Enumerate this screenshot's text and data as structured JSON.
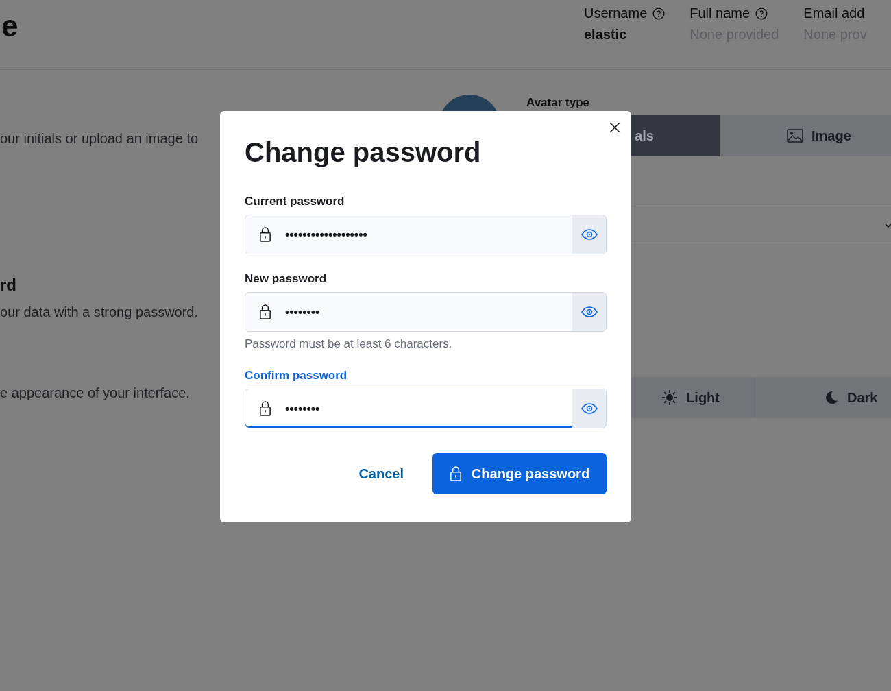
{
  "header": {
    "title": "e",
    "details": [
      {
        "label": "Username",
        "help": true,
        "value": "elastic",
        "empty": false
      },
      {
        "label": "Full name",
        "help": true,
        "value": "None provided",
        "empty": true
      },
      {
        "label": "Email add",
        "help": false,
        "value": "None prov",
        "empty": true
      }
    ]
  },
  "avatar_section": {
    "description": "our initials or upload an image to",
    "avatar_label": "Avatar type",
    "options": [
      {
        "label": "als",
        "selected": true
      },
      {
        "label": "Image",
        "selected": false
      }
    ]
  },
  "password_section": {
    "title": "rd",
    "description": "our data with a strong password."
  },
  "theme_section": {
    "description": "e appearance of your interface.",
    "options": [
      {
        "label": "Light",
        "selected": false
      },
      {
        "label": "Dark",
        "selected": false
      }
    ]
  },
  "dialog": {
    "title": "Change password",
    "fields": [
      {
        "label": "Current password",
        "value": "•••••••••••••••••••",
        "focused": false
      },
      {
        "label": "New password",
        "value": "••••••••",
        "help": "Password must be at least 6 characters.",
        "focused": false
      },
      {
        "label": "Confirm password",
        "value": "••••••••",
        "focused": true
      }
    ],
    "cancel": "Cancel",
    "submit": "Change password"
  }
}
